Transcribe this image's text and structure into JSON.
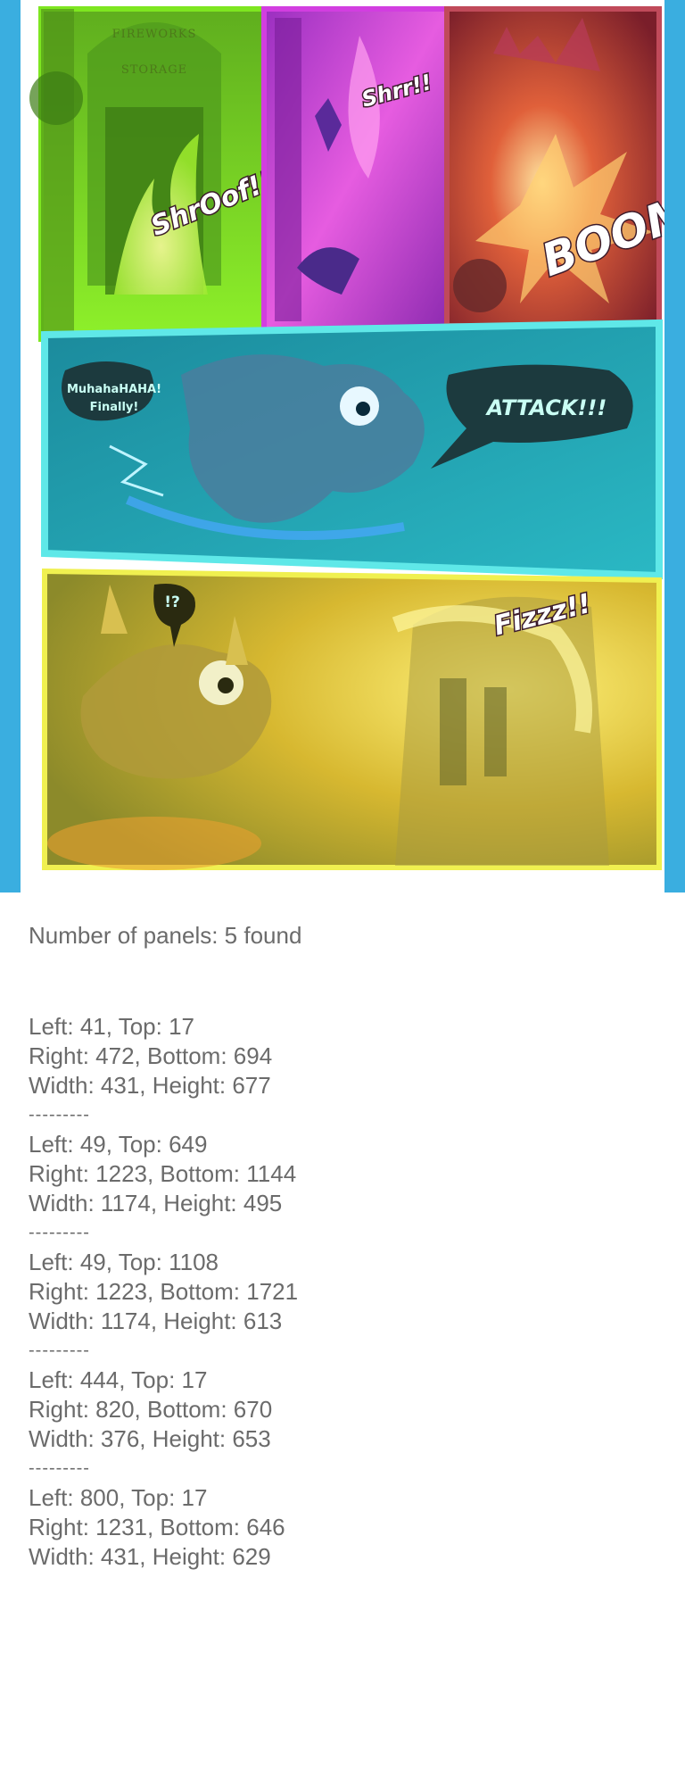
{
  "colors": {
    "frame": "#3aaee0",
    "panel1": "#7ee620",
    "panel2": "#d23ee0",
    "panel3": "#b83a3a",
    "panel4": "#20a8b8",
    "panel5": "#e8d020",
    "text": "#6b6b6b"
  },
  "comic": {
    "sign_line1": "FIREWORKS",
    "sign_line2": "STORAGE",
    "sfx_panel1": "ShrOof!!",
    "sfx_panel2": "Shrr!!",
    "sfx_panel3": "BOOM!",
    "bubble_line1": "MuhahaHAHA!",
    "bubble_line2": "Finally!",
    "attack_text": "ATTACK!!!",
    "surprise_text": "!?",
    "fizz_text": "Fizzz!!"
  },
  "summary": {
    "count_label": "Number of panels: 5 found"
  },
  "separator": "---------",
  "panels": [
    {
      "pos": "Left: 41, Top: 17",
      "end": "Right: 472, Bottom: 694",
      "size": "Width: 431, Height: 677"
    },
    {
      "pos": "Left: 49, Top: 649",
      "end": "Right: 1223, Bottom: 1144",
      "size": "Width: 1174, Height: 495"
    },
    {
      "pos": "Left: 49, Top: 1108",
      "end": "Right: 1223, Bottom: 1721",
      "size": "Width: 1174, Height: 613"
    },
    {
      "pos": "Left: 444, Top: 17",
      "end": "Right: 820, Bottom: 670",
      "size": "Width: 376, Height: 653"
    },
    {
      "pos": "Left: 800, Top: 17",
      "end": "Right: 1231, Bottom: 646",
      "size": "Width: 431, Height: 629"
    }
  ]
}
